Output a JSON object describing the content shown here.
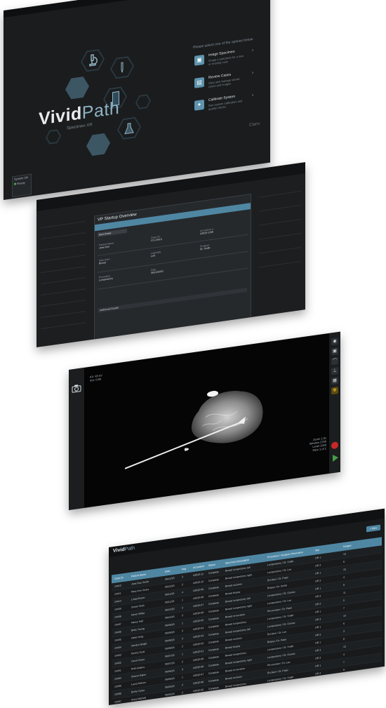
{
  "screens": {
    "home": {
      "brand_bold": "Vivid",
      "brand_light": "Path",
      "brand_sub": "Specimen XR",
      "menu_heading": "Please select one of the options below",
      "menu": [
        {
          "title": "Image Specimen",
          "desc": "Image a specimen for a new or existing case",
          "icon": "specimen-icon"
        },
        {
          "title": "Review Cases",
          "desc": "View and manage stored cases and images",
          "icon": "review-icon"
        },
        {
          "title": "Calibrate System",
          "desc": "Run system calibration and quality checks",
          "icon": "calibrate-icon"
        }
      ],
      "footer_logo": "Clarix",
      "status_title": "System OK",
      "status_line": "Ready"
    },
    "case_overview": {
      "dialog_title": "VP Startup Overview",
      "tab": "Basic Details",
      "fields": [
        {
          "label": "Patient Name",
          "value": "Jane Doe"
        },
        {
          "label": "Case ID",
          "value": "CX-10412"
        },
        {
          "label": "Accession #",
          "value": "A2023-1188"
        },
        {
          "label": "Specimen",
          "value": "Breast"
        },
        {
          "label": "Laterality",
          "value": "Left"
        },
        {
          "label": "Surgeon",
          "value": "Dr. Smith"
        },
        {
          "label": "Procedure",
          "value": "Lumpectomy"
        },
        {
          "label": "Date",
          "value": "06/12/2023"
        }
      ],
      "section": "Additional Details"
    },
    "viewer": {
      "overlay_top": [
        "KV: 45 kV",
        "mA: 0.80"
      ],
      "overlay_bottom": [
        "Zoom 1.0x",
        "Window 2700",
        "Level 1550",
        "Slice 1 of 1"
      ],
      "tools": [
        "camera-icon",
        "image-icon",
        "curve-icon",
        "ruler-icon",
        "grid-icon",
        "radiation-icon"
      ],
      "stop_label": "Stop",
      "acquire_label": "Acquire"
    },
    "case_list": {
      "logo_bold": "Vivid",
      "logo_light": "Path",
      "new_button": "+ New",
      "columns": [
        "Case ID",
        "Patient Name",
        "Date",
        "Img",
        "Accession",
        "Status",
        "Specimen Description",
        "Procedure / Surgeon Information",
        "Site",
        "Images"
      ],
      "rows": [
        [
          "10412",
          "Jane Doe Smith",
          "06/12/23",
          "3",
          "A2023-11",
          "Complete",
          "Breast lumpectomy left",
          "Lumpectomy / Dr. Smith",
          "OR 1",
          "12"
        ],
        [
          "10411",
          "Mary Ann Jones",
          "06/12/23",
          "2",
          "A2023-10",
          "Complete",
          "Breast lumpectomy right",
          "Lumpectomy / Dr. Lee",
          "OR 2",
          "8"
        ],
        [
          "10410",
          "Linda Brown",
          "06/11/23",
          "4",
          "A2023-09",
          "Complete",
          "Breast excision",
          "Excision / Dr. Patel",
          "OR 1",
          "15"
        ],
        [
          "10409",
          "Susan Clark",
          "06/11/23",
          "1",
          "A2023-08",
          "Complete",
          "Breast biopsy",
          "Biopsy / Dr. Smith",
          "OR 3",
          "4"
        ],
        [
          "10408",
          "Karen White",
          "06/10/23",
          "2",
          "A2023-07",
          "Complete",
          "Breast lumpectomy left",
          "Lumpectomy / Dr. Gomez",
          "OR 1",
          "9"
        ],
        [
          "10407",
          "Nancy Hall",
          "06/10/23",
          "3",
          "A2023-06",
          "Complete",
          "Breast lumpectomy right",
          "Lumpectomy / Dr. Lee",
          "OR 2",
          "11"
        ],
        [
          "10406",
          "Betty Young",
          "06/09/23",
          "1",
          "A2023-05",
          "Complete",
          "Breast re-excision",
          "Re-excision / Dr. Patel",
          "OR 2",
          "5"
        ],
        [
          "10405",
          "Helen King",
          "06/09/23",
          "2",
          "A2023-04",
          "Complete",
          "Breast lumpectomy",
          "Lumpectomy / Dr. Smith",
          "OR 1",
          "7"
        ],
        [
          "10404",
          "Sandra Wright",
          "06/08/23",
          "3",
          "A2023-03",
          "Complete",
          "Breast lumpectomy left",
          "Lumpectomy / Dr. Gomez",
          "OR 3",
          "10"
        ],
        [
          "10403",
          "Donna Scott",
          "06/08/23",
          "2",
          "A2023-02",
          "Complete",
          "Breast excision",
          "Excision / Dr. Lee",
          "OR 1",
          "6"
        ],
        [
          "10402",
          "Carol Green",
          "06/07/23",
          "1",
          "A2023-01",
          "Complete",
          "Breast biopsy",
          "Biopsy / Dr. Patel",
          "OR 2",
          "3"
        ],
        [
          "10401",
          "Ruth Adams",
          "06/07/23",
          "2",
          "A2022-99",
          "Complete",
          "Breast lumpectomy",
          "Lumpectomy / Dr. Smith",
          "OR 1",
          "8"
        ],
        [
          "10400",
          "Sharon Baker",
          "06/06/23",
          "3",
          "A2022-98",
          "Complete",
          "Breast lumpectomy right",
          "Lumpectomy / Dr. Gomez",
          "OR 3",
          "12"
        ],
        [
          "10399",
          "Laura Nelson",
          "06/06/23",
          "1",
          "A2022-97",
          "Complete",
          "Breast re-excision",
          "Re-excision / Dr. Lee",
          "OR 2",
          "4"
        ],
        [
          "10398",
          "Emily Carter",
          "06/05/23",
          "2",
          "A2022-96",
          "Complete",
          "Breast excision",
          "Excision / Dr. Patel",
          "OR 1",
          "7"
        ],
        [
          "10397",
          "Anna Mitchell",
          "06/05/23",
          "2",
          "A2022-95",
          "Complete",
          "Breast lumpectomy",
          "Lumpectomy / Dr. Smith",
          "OR 2",
          "9"
        ]
      ]
    }
  },
  "colors": {
    "accent": "#4f87a3",
    "background": "#1a1c1e",
    "stop": "#c62828",
    "go": "#43a047"
  }
}
